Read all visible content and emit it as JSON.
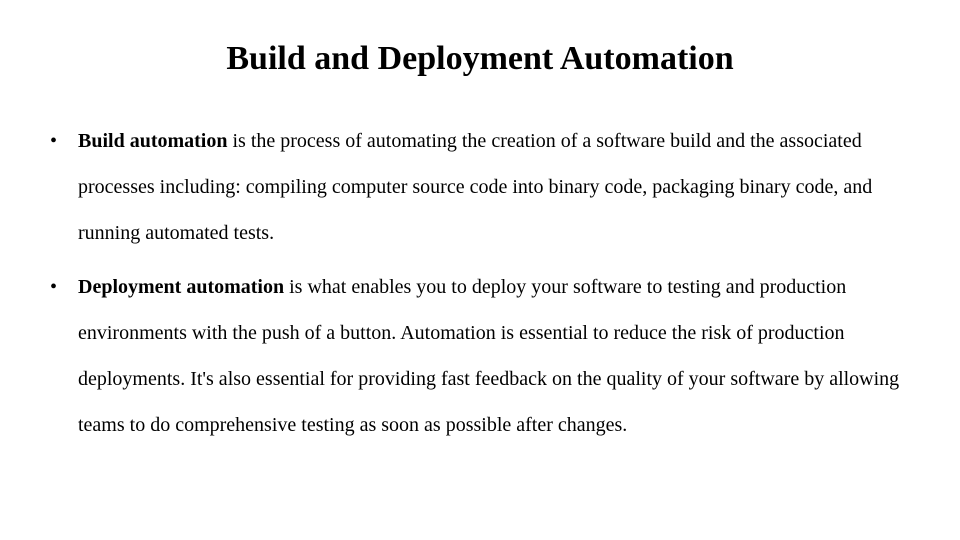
{
  "slide": {
    "title": "Build and Deployment Automation",
    "bullets": [
      {
        "term": "Build automation",
        "text": " is the process of automating the creation of a software build and the associated processes including: compiling computer source code into binary code, packaging binary code, and running automated tests."
      },
      {
        "term": "Deployment automation",
        "text": " is what enables you to deploy your software to testing and production environments with the push of a button. Automation is essential to reduce the risk of production deployments. It's also essential for providing fast feedback on the quality of your software by allowing teams to do comprehensive testing as soon as possible after changes."
      }
    ]
  }
}
